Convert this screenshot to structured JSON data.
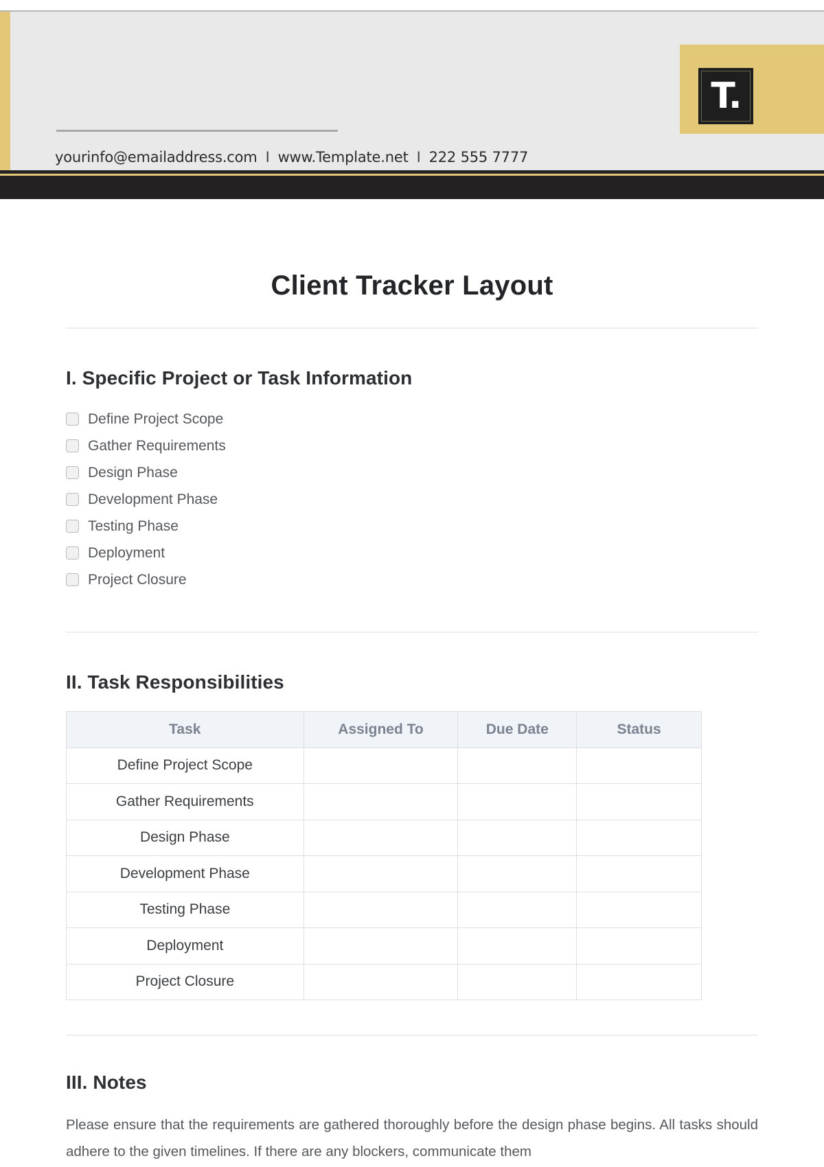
{
  "header": {
    "email": "yourinfo@emailaddress.com",
    "website": "www.Template.net",
    "phone": "222 555 7777",
    "separator": "I",
    "logo_text": "T.",
    "logo_icon": "template-logo",
    "colors": {
      "gold": "#e2c877",
      "dark": "#242122",
      "band": "#e9e9e9"
    }
  },
  "document": {
    "title": "Client Tracker Layout"
  },
  "section1": {
    "heading": "I. Specific Project or Task Information",
    "items": [
      {
        "label": "Define Project Scope",
        "checked": false
      },
      {
        "label": "Gather Requirements",
        "checked": false
      },
      {
        "label": "Design Phase",
        "checked": false
      },
      {
        "label": "Development Phase",
        "checked": false
      },
      {
        "label": "Testing Phase",
        "checked": false
      },
      {
        "label": "Deployment",
        "checked": false
      },
      {
        "label": "Project Closure",
        "checked": false
      }
    ]
  },
  "section2": {
    "heading": "II. Task Responsibilities",
    "columns": [
      "Task",
      "Assigned To",
      "Due Date",
      "Status"
    ],
    "rows": [
      [
        "Define Project Scope",
        "",
        "",
        ""
      ],
      [
        "Gather Requirements",
        "",
        "",
        ""
      ],
      [
        "Design Phase",
        "",
        "",
        ""
      ],
      [
        "Development Phase",
        "",
        "",
        ""
      ],
      [
        "Testing Phase",
        "",
        "",
        ""
      ],
      [
        "Deployment",
        "",
        "",
        ""
      ],
      [
        "Project Closure",
        "",
        "",
        ""
      ]
    ]
  },
  "section3": {
    "heading": "III. Notes",
    "text": "Please ensure that the requirements are gathered thoroughly before the design phase begins. All tasks should adhere to the given timelines. If there are any blockers, communicate them"
  }
}
